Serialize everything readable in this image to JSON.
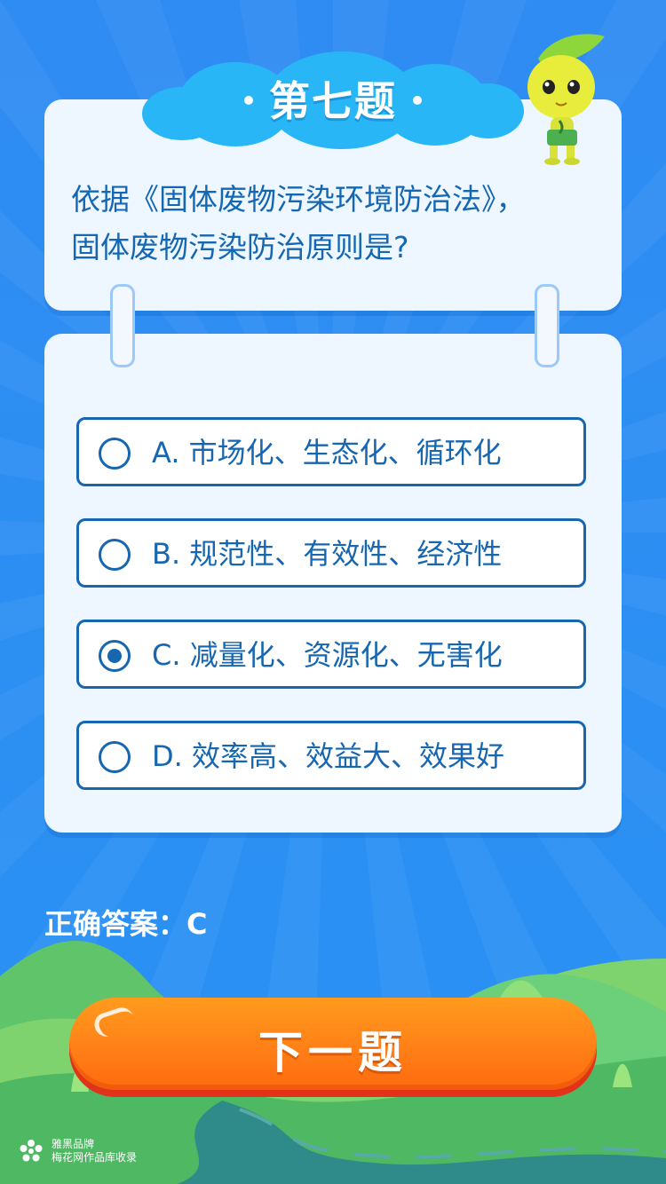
{
  "colors": {
    "background": "#2a8ff0",
    "card": "#eef6ff",
    "primary_text": "#1666b0",
    "cloud": "#29b6f6",
    "button": "#ff7d14",
    "button_shadow": "#e2321a"
  },
  "header": {
    "title": "第七题",
    "mascot_icon": "leaf-mascot-icon"
  },
  "question": {
    "line1": "依据《固体废物污染环境防治法》，",
    "line2": "固体废物污染防治原则是?"
  },
  "options": [
    {
      "label": "A. 市场化、生态化、循环化",
      "selected": false
    },
    {
      "label": "B. 规范性、有效性、经济性",
      "selected": false
    },
    {
      "label": "C. 减量化、资源化、无害化",
      "selected": true
    },
    {
      "label": "D. 效率高、效益大、效果好",
      "selected": false
    }
  ],
  "answer": {
    "text": "正确答案：C"
  },
  "next_button": {
    "label": "下一题"
  },
  "watermark": {
    "line1": "雅黑品牌",
    "line2": "梅花网作品库收录",
    "icon": "plum-flower-icon"
  }
}
